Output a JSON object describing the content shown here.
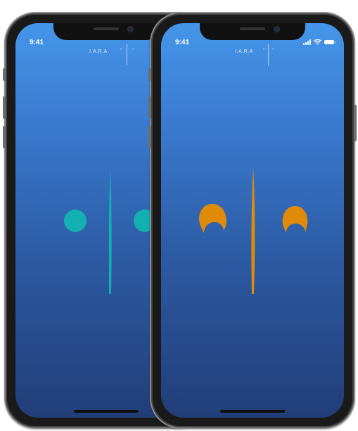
{
  "screens": [
    {
      "status_time": "9:41",
      "app_title": "I.A.R.A",
      "title_marks": [
        "°",
        "°"
      ],
      "shapes_color": "#12b0b0",
      "shapes": [
        "left-circle",
        "vertical-bar",
        "right-circle"
      ]
    },
    {
      "status_time": "9:41",
      "app_title": "I.A.R.A",
      "title_marks": [
        "°",
        "°"
      ],
      "shapes_color": "#e08a0a",
      "shapes": [
        "left-crescent",
        "vertical-bar",
        "right-crescent"
      ],
      "status_icons": [
        "signal-icon",
        "wifi-icon",
        "battery-icon"
      ]
    }
  ],
  "colors": {
    "screen_top": "#4596ea",
    "screen_bottom": "#213e78",
    "teal": "#12b0b0",
    "orange": "#e08a0a"
  }
}
